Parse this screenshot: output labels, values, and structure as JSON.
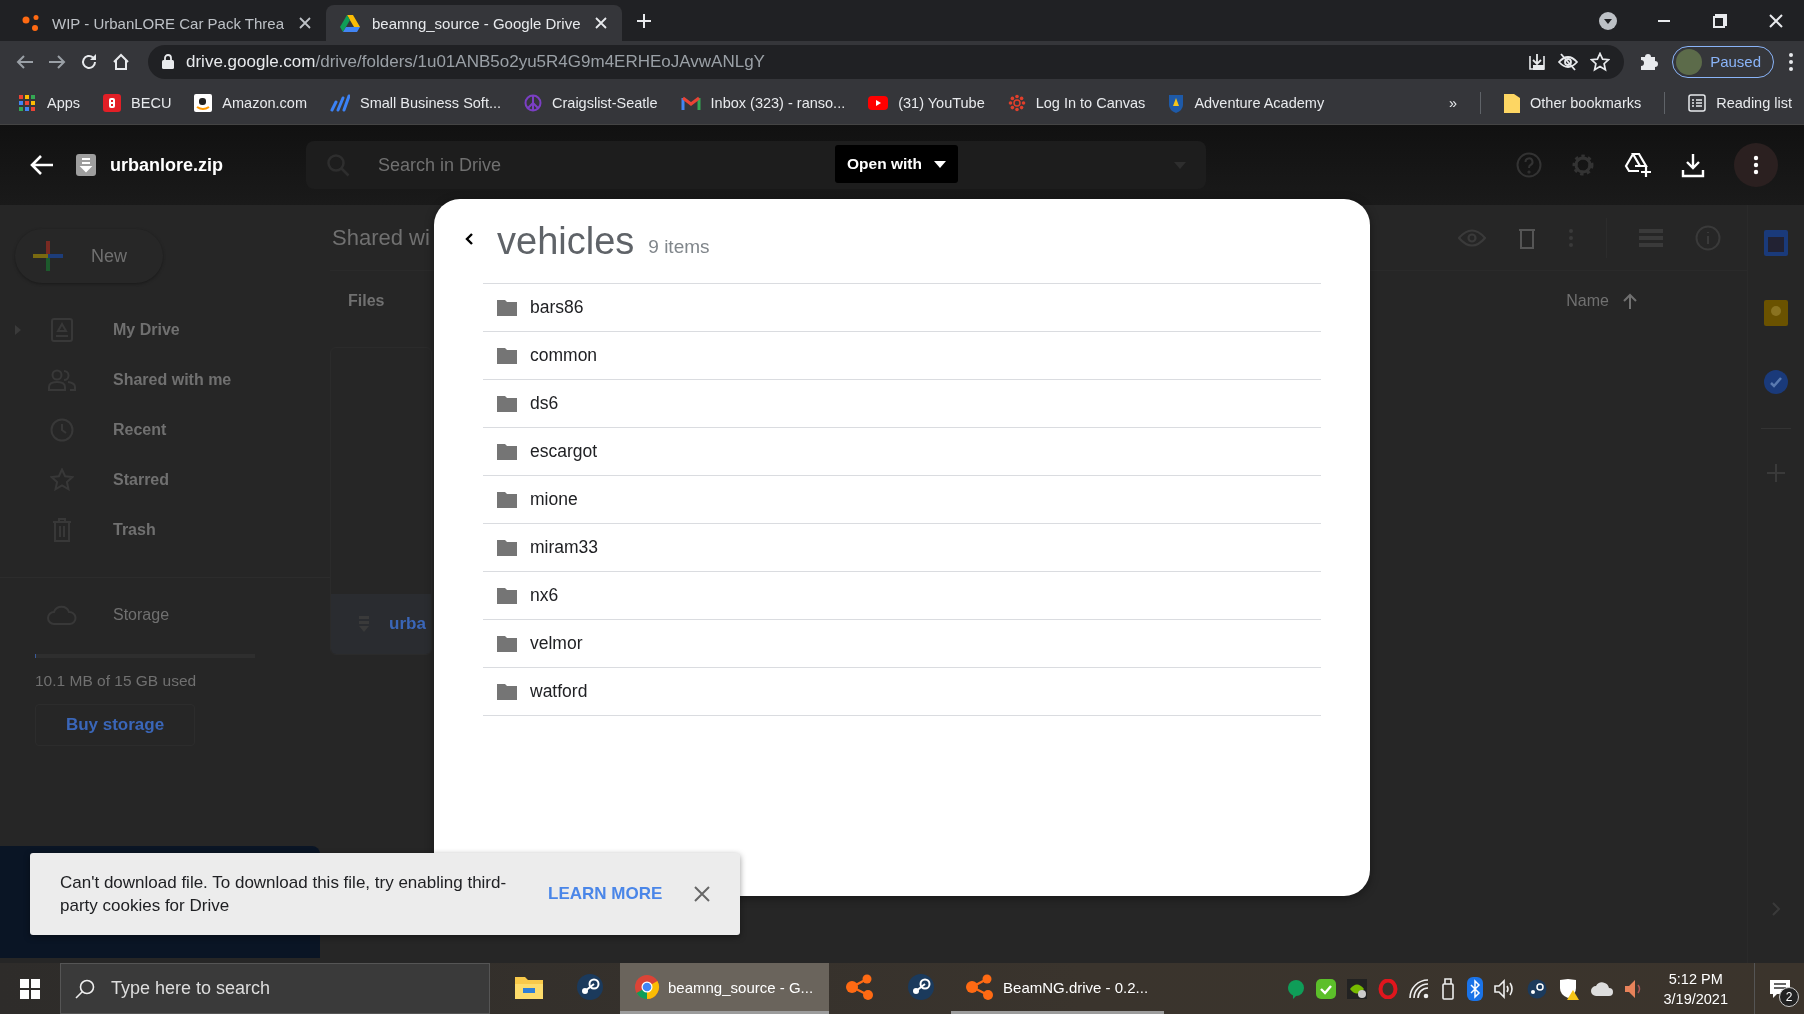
{
  "browser": {
    "tabs": [
      {
        "title": "WIP - UrbanLORE Car Pack Threa",
        "kind": "beamng",
        "selected": false
      },
      {
        "title": "beamng_source - Google Drive",
        "kind": "drive",
        "selected": true
      }
    ],
    "address": {
      "host": "drive.google.com",
      "path": "/drive/folders/1u01ANB5o2yu5R4G9m4ERHEoJAvwANLgY"
    },
    "profile": {
      "label": "Paused"
    },
    "bookmarks": [
      {
        "label": "Apps",
        "kind": "apps"
      },
      {
        "label": "BECU",
        "kind": "redsquare"
      },
      {
        "label": "Amazon.com",
        "kind": "smile"
      },
      {
        "label": "Small Business Soft...",
        "kind": "wave"
      },
      {
        "label": "Craigslist-Seatle",
        "kind": "peace"
      },
      {
        "label": "Inbox (323) - ranso...",
        "kind": "mail"
      },
      {
        "label": "(31) YouTube",
        "kind": "video"
      },
      {
        "label": "Log In to Canvas",
        "kind": "ring"
      },
      {
        "label": "Adventure Academy",
        "kind": "shield"
      }
    ],
    "overflow": "»",
    "other_bookmarks": "Other bookmarks",
    "reading_list": "Reading list"
  },
  "viewer": {
    "file_name": "urbanlore.zip",
    "open_with": "Open with"
  },
  "drive": {
    "search": {
      "placeholder": "Search in Drive"
    },
    "new_button": "New",
    "nav": [
      {
        "label": "My Drive",
        "kind": "drive",
        "expandable": true
      },
      {
        "label": "Shared with me",
        "kind": "people",
        "expandable": false
      },
      {
        "label": "Recent",
        "kind": "clock",
        "expandable": false
      },
      {
        "label": "Starred",
        "kind": "star",
        "expandable": false
      },
      {
        "label": "Trash",
        "kind": "trash",
        "expandable": false
      }
    ],
    "storage": {
      "label": "Storage",
      "level": 0.001,
      "usage": "10.1 MB of 15 GB used",
      "buy": "Buy storage"
    },
    "location": "Shared wi",
    "section": "Files",
    "sort": "Name",
    "file_card": {
      "name": "urba"
    }
  },
  "archive": {
    "folder": "vehicles",
    "count": "9 items",
    "items": [
      {
        "name": "bars86"
      },
      {
        "name": "common"
      },
      {
        "name": "ds6"
      },
      {
        "name": "escargot"
      },
      {
        "name": "mione"
      },
      {
        "name": "miram33"
      },
      {
        "name": "nx6"
      },
      {
        "name": "velmor"
      },
      {
        "name": "watford"
      }
    ]
  },
  "snackbar": {
    "message": "Can't download file. To download this file, try enabling third-party cookies for Drive",
    "action": "LEARN MORE"
  },
  "taskbar": {
    "search": {
      "placeholder": "Type here to search"
    },
    "apps": [
      {
        "kind": "explorer",
        "selected": false
      },
      {
        "kind": "steam",
        "selected": false
      },
      {
        "kind": "chrome",
        "label": "beamng_source - G...",
        "selected": true
      },
      {
        "kind": "beamng",
        "selected": false
      },
      {
        "kind": "steam",
        "selected": false
      },
      {
        "kind": "beamng",
        "label": "BeamNG.drive - 0.2...",
        "selected": false
      }
    ],
    "time": "5:12 PM",
    "date": "3/19/2021",
    "notifications": "2"
  }
}
